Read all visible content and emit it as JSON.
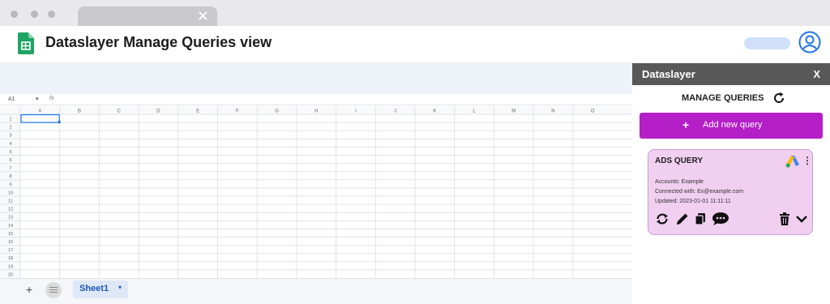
{
  "browser": {
    "close_glyph": "✕"
  },
  "header": {
    "title": "Dataslayer Manage Queries view"
  },
  "sheet": {
    "cell_ref": "A1",
    "cell_ref_caret": "▾",
    "fx_label": "fx",
    "columns": [
      "A",
      "B",
      "C",
      "D",
      "E",
      "F",
      "G",
      "H",
      "I",
      "J",
      "K",
      "L",
      "M",
      "N",
      "O"
    ],
    "rows": [
      "1",
      "2",
      "3",
      "4",
      "5",
      "6",
      "7",
      "8",
      "9",
      "10",
      "11",
      "12",
      "13",
      "14",
      "15",
      "16",
      "17",
      "18",
      "19",
      "20"
    ],
    "add_sheet_label": "+",
    "tab_label": "Sheet1",
    "tab_caret": "▾"
  },
  "panel": {
    "title": "Dataslayer",
    "close_label": "X",
    "section_title": "MANAGE QUERIES",
    "add_button_plus": "+",
    "add_button_label": "Add new query",
    "accent": "#b41fc8",
    "query_card": {
      "title": "ADS QUERY",
      "menu_label": "⋮",
      "accounts": "Accounts: Example",
      "connected": "Connected with: Ex@example.com",
      "updated": "Updated: 2023-01-01 11:11:11",
      "card_color": "#f1cff1",
      "actions": [
        "refresh-icon",
        "pencil-icon",
        "copy-icon",
        "comment-icon",
        "trash-icon",
        "chevron-down-icon"
      ]
    }
  }
}
